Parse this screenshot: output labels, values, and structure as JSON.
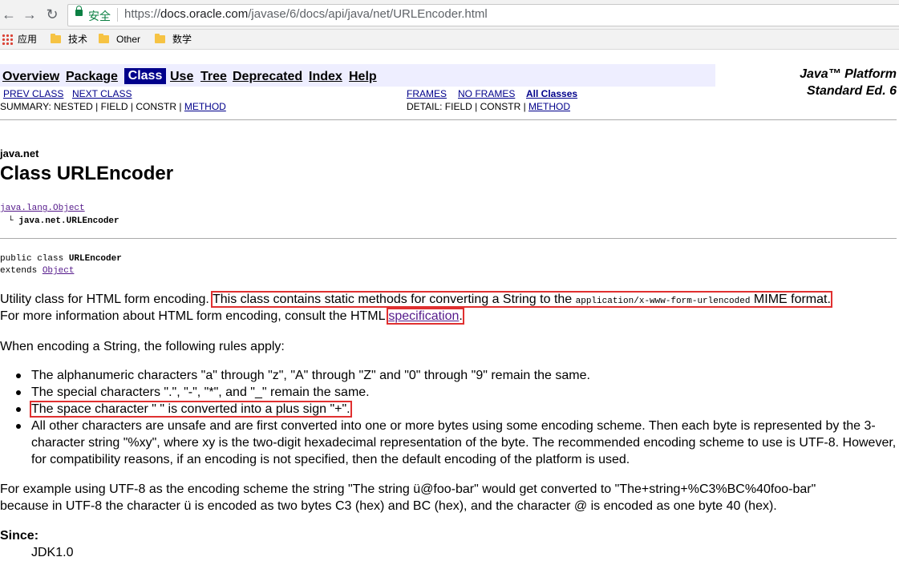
{
  "browser": {
    "back_icon": "←",
    "forward_icon": "→",
    "reload_icon": "↻",
    "secure_label": "安全",
    "url_scheme": "https://",
    "url_host": "docs.oracle.com",
    "url_path": "/javase/6/docs/api/java/net/URLEncoder.html"
  },
  "bookmarks": [
    {
      "label": "应用",
      "icon": "apps-icon"
    },
    {
      "label": "技术",
      "icon": "folder-icon"
    },
    {
      "label": "Other",
      "icon": "folder-icon"
    },
    {
      "label": "数学",
      "icon": "folder-icon"
    }
  ],
  "navbar": {
    "overview": "Overview",
    "package": "Package",
    "class": "Class",
    "use": "Use",
    "tree": "Tree",
    "deprecated": "Deprecated",
    "index": "Index",
    "help": "Help"
  },
  "platform": {
    "line1": "Java™ Platform",
    "line2": "Standard Ed. 6"
  },
  "subnav": {
    "prev_class": "PREV CLASS",
    "next_class": "NEXT CLASS",
    "frames": "FRAMES",
    "no_frames": "NO FRAMES",
    "all_classes": "All Classes",
    "summary_text": "SUMMARY: NESTED | FIELD | CONSTR | ",
    "summary_method": "METHOD",
    "detail_text": "DETAIL: FIELD | CONSTR | ",
    "detail_method": "METHOD"
  },
  "class_info": {
    "package": "java.net",
    "title": "Class URLEncoder",
    "parent": "java.lang.Object",
    "tree_prefix": "└",
    "self": "java.net.URLEncoder",
    "decl_line1_prefix": "public class ",
    "decl_line1_name": "URLEncoder",
    "decl_line2_prefix": "extends ",
    "decl_line2_link": "Object"
  },
  "description": {
    "p1_start": "Utility class for HTML form encoding.",
    "p1_highlight_a": "This class contains static methods for converting a String to the ",
    "p1_highlight_code": "application/x-www-form-urlencoded",
    "p1_highlight_b": " MIME format.",
    "p2_start": "For more information about HTML form encoding, consult the HTML ",
    "p2_link": "specification",
    "p2_end": ".",
    "rules_intro": "When encoding a String, the following rules apply:",
    "rule1": "The alphanumeric characters \"a\" through \"z\", \"A\" through \"Z\" and \"0\" through \"9\" remain the same.",
    "rule2": "The special characters \".\", \"-\", \"*\", and \"_\" remain the same.",
    "rule3": "The space character \"   \" is converted into a plus sign \"+\".",
    "rule4": "All other characters are unsafe and are first converted into one or more bytes using some encoding scheme. Then each byte is represented by the 3-character string \"%xy\", where xy is the two-digit hexadecimal representation of the byte. The recommended encoding scheme to use is UTF-8. However, for compatibility reasons, if an encoding is not specified, then the default encoding of the platform is used.",
    "example_line1": "For example using UTF-8 as the encoding scheme the string \"The string ü@foo-bar\" would get converted to \"The+string+%C3%BC%40foo-bar\"",
    "example_line2": "because in UTF-8 the character ü is encoded as two bytes C3 (hex) and BC (hex), and the character @ is encoded as one byte 40 (hex).",
    "since_label": "Since:",
    "since_value": "JDK1.0"
  },
  "colors": {
    "navbar_bg": "#eeeeff",
    "navbar_selected": "#00008b",
    "highlight_box": "#e03030",
    "secure_green": "#0b8043"
  }
}
